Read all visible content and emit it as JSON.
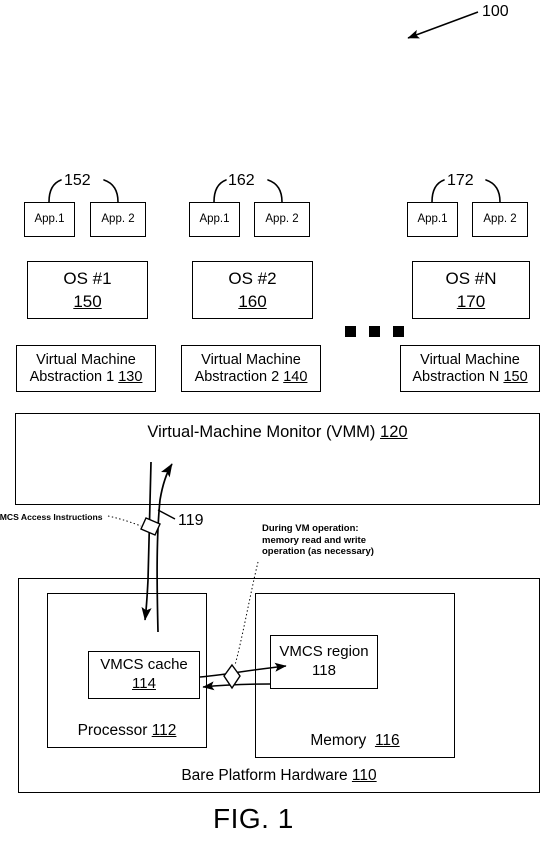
{
  "figure": {
    "caption": "FIG. 1",
    "system_ref": "100"
  },
  "columns": [
    {
      "id": "column-1",
      "apps": [
        {
          "label": "App.1"
        },
        {
          "label": "App. 2"
        }
      ],
      "app_bracket_ref": "152",
      "os": {
        "name": "OS #1",
        "ref": "150"
      },
      "vm": {
        "line1": "Virtual Machine",
        "line2": "Abstraction 1",
        "ref": "130"
      }
    },
    {
      "id": "column-2",
      "apps": [
        {
          "label": "App.1"
        },
        {
          "label": "App. 2"
        }
      ],
      "app_bracket_ref": "162",
      "os": {
        "name": "OS #2",
        "ref": "160"
      },
      "vm": {
        "line1": "Virtual Machine",
        "line2": "Abstraction 2",
        "ref": "140"
      }
    },
    {
      "id": "column-n",
      "apps": [
        {
          "label": "App.1"
        },
        {
          "label": "App. 2"
        }
      ],
      "app_bracket_ref": "172",
      "os": {
        "name": "OS #N",
        "ref": "170"
      },
      "vm": {
        "line1": "Virtual Machine",
        "line2": "Abstraction N",
        "ref": "150"
      }
    }
  ],
  "ellipsis_dots": 3,
  "vmm": {
    "label": "Virtual-Machine Monitor (VMM)",
    "ref": "120"
  },
  "annotations": {
    "vmcs_access_instructions": "VMCS Access Instructions",
    "vmcs_access_ref": "119",
    "memory_operation": "During VM operation: memory read and write operation (as necessary)"
  },
  "hardware": {
    "label": "Bare Platform Hardware",
    "ref": "110",
    "processor": {
      "label": "Processor",
      "ref": "112",
      "cache": {
        "line1": "VMCS cache",
        "ref": "114"
      }
    },
    "memory": {
      "label": "Memory",
      "ref": "116",
      "region": {
        "line1": "VMCS region",
        "ref": "118"
      }
    }
  }
}
